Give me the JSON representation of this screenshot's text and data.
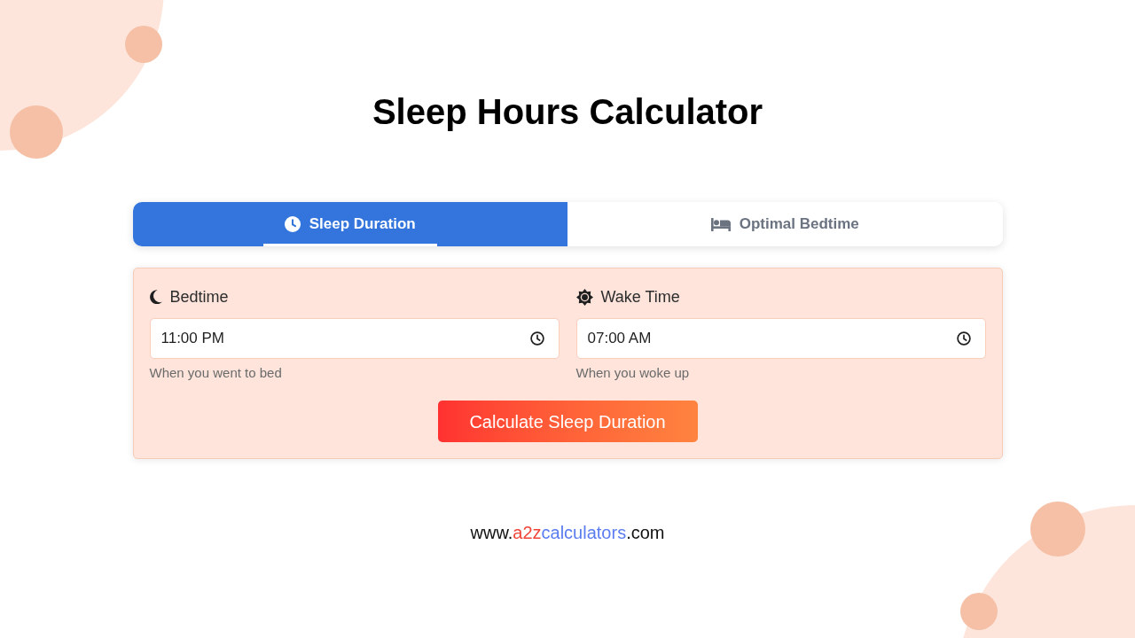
{
  "title": "Sleep Hours Calculator",
  "tabs": [
    {
      "label": "Sleep Duration",
      "selected": true
    },
    {
      "label": "Optimal Bedtime",
      "selected": false
    }
  ],
  "form": {
    "fields": [
      {
        "label": "Bedtime",
        "value": "11:00 PM",
        "hint": "When you went to bed"
      },
      {
        "label": "Wake Time",
        "value": "07:00 AM",
        "hint": "When you woke up"
      }
    ],
    "button": "Calculate Sleep Duration"
  },
  "footer": {
    "parts": [
      {
        "text": "www.",
        "color": "#111111"
      },
      {
        "text": "a2z",
        "color": "#f0453a"
      },
      {
        "text": "calculators",
        "color": "#5b7cf0"
      },
      {
        "text": ".com",
        "color": "#111111"
      }
    ]
  }
}
